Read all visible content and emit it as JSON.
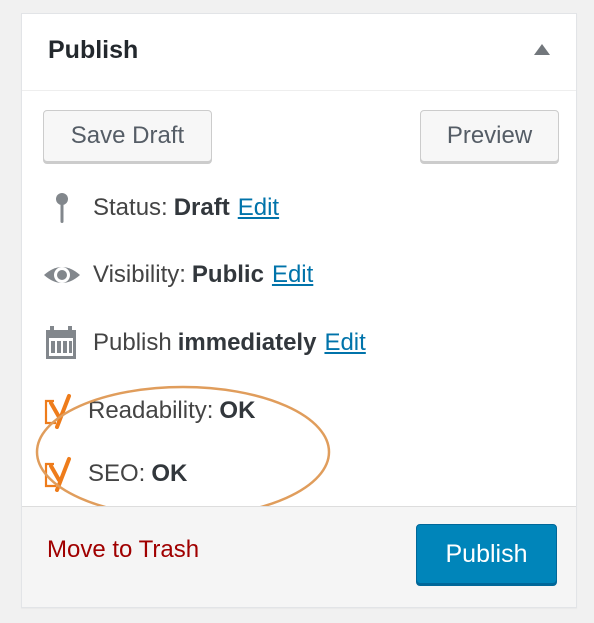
{
  "panel": {
    "title": "Publish",
    "toggle_icon": "triangle-up-icon"
  },
  "actions": {
    "save_draft_label": "Save Draft",
    "preview_label": "Preview"
  },
  "status": {
    "icon": "pin-icon",
    "label": "Status:",
    "value": "Draft",
    "edit_label": "Edit"
  },
  "visibility": {
    "icon": "eye-icon",
    "label": "Visibility:",
    "value": "Public",
    "edit_label": "Edit"
  },
  "schedule": {
    "icon": "calendar-icon",
    "label": "Publish",
    "value": "immediately",
    "edit_label": "Edit"
  },
  "yoast": {
    "icon": "yoast-icon",
    "readability_label": "Readability:",
    "readability_value": "OK",
    "seo_label": "SEO:",
    "seo_value": "OK",
    "highlight_color": "#e09d5c",
    "icon_color": "#ee7c1b"
  },
  "footer": {
    "trash_label": "Move to Trash",
    "publish_label": "Publish"
  },
  "colors": {
    "link": "#0073aa",
    "trash": "#a00000",
    "publish_button": "#0085ba"
  }
}
